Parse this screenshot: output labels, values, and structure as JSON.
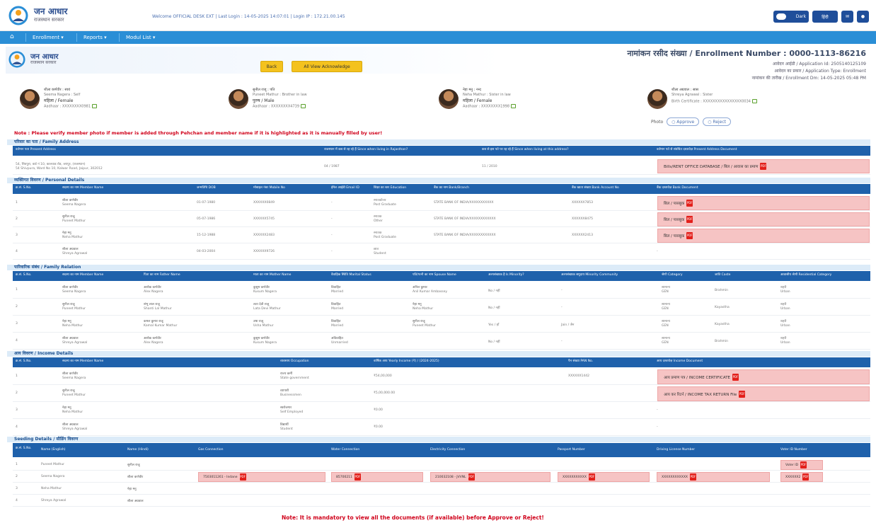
{
  "app": {
    "title": "जन आधार",
    "subtitle": "राजस्थान सरकार",
    "welcome": "Welcome OFFICIAL DESK EXT | Last Login : 14-05-2025 14:07:01 | Login IP : 172.21.00.145",
    "toggle_label": "Dark",
    "lang_button": "हिंदी",
    "logo_color": "#2a4d8f",
    "accent": "#1f61ab"
  },
  "nav": {
    "home_icon": "home-icon",
    "items": [
      "Enrollment ▾",
      "Reports ▾",
      "Modul List ▾"
    ]
  },
  "header": {
    "logo_title": "जन आधार",
    "logo_sub": "राजस्थान सरकार",
    "back_button": "Back",
    "view_btn": "All View Acknowledge",
    "enrollment": "नामांकन रसीद संख्या / Enrollment Number : 0000-1113-86216",
    "application_id": "आवेदन आईडी / Application Id: 2505140125109",
    "application_type": "आवेदन का प्रकार / Application Type: Enrollment",
    "enrollment_date": "नामांकन की तारीख / Enrollment Dm: 14-05-2025 05:48 PM"
  },
  "members": [
    {
      "l1": "शीला कर्णवीर : स्वयं",
      "l2": "Seema Nagera : Self",
      "l3": "महिला / Female",
      "l4": "Aadhaar : XXXXXXXX0981"
    },
    {
      "l1": "सुनील राजू : पति",
      "l2": "Puneet Mathur : Brother in law",
      "l3": "पुरुष / Male",
      "l4": "Aadhaar : XXXXXXXX4739"
    },
    {
      "l1": "नेहा मनु : नन्द",
      "l2": "Neha Mathur : Sister in law",
      "l3": "महिला / Female",
      "l4": "Aadhaar : XXXXXXXX1998"
    },
    {
      "l1": "शीला अग्रवाल : सास",
      "l2": "Shreya Agrawal : Sister",
      "l3": "",
      "l4": "Birth Certificate : XXXXXXXXXXXXXXXX0034"
    }
  ],
  "photo": {
    "label": "Photo",
    "approve": "Approve",
    "reject": "Reject"
  },
  "note_top": "Note : Please verify member photo if member is added through Pehchan and member name if it is highlighted as it is manually filled by user!",
  "family_address": {
    "title": "परिवार का पता / Family Address",
    "headers": [
      "वर्तमान पता Present Address",
      "राजस्थान में कब से रह रहे हैं Since when living in Rajasthan?",
      "कब से इस पते पर रह रहे हैं Since when living at this address?",
      "वर्तमान पते से संबंधित दस्तावेज़ Present Address Document"
    ],
    "row": [
      "54, शिवपुरा, वार्ड नं 10, कालवाड रोड, जयपुर, (राजस्थान)",
      "04 / 1987",
      "11 / 2010",
      "Bills/RENT OFFICE DATABASE / बिल / आवास का प्रमाण"
    ],
    "row_sub": "54 Shivpura, Ward No 10, Kalwar Road, Jaipur, 302012"
  },
  "personal": {
    "title": "व्यक्तिगत विवरण / Personal Details",
    "headers": [
      "क्र.सं. S.No.",
      "सदस्य का नाम Member Name",
      "जन्मतिथि DOB",
      "मोबाइल नंबर Mobile No",
      "ईमेल आईडी Email ID",
      "शिक्षा का स्तर Education",
      "बैंक का नाम Bank/Branch",
      "बैंक खाता संख्या Bank Account No",
      "बैंक दस्तावेज़ Bank Document"
    ],
    "rows": [
      [
        "1",
        "शीला कर्णवीर",
        "Seema Nagera",
        "01-07-1980",
        "XXXXXX0849",
        "-",
        "स्नातकोत्तर",
        "Post Graduate",
        "STATE BANK OF INDIA/XXXXXXXXXXX",
        "XXXXXX7853",
        "बिल / पासबुक"
      ],
      [
        "2",
        "सुनील राजू",
        "Puneet Mathur",
        "05-07-1986",
        "XXXXXX5745",
        "-",
        "स्नातक",
        "Other",
        "STATE BANK OF INDIA/XXXXXXXXXXXX",
        "XXXXXX8475",
        "बिल / पासबुक"
      ],
      [
        "3",
        "नेहा मनु",
        "Neha Mathur",
        "15-12-1988",
        "XXXXXX2483",
        "-",
        "स्नातक",
        "Post Graduate",
        "STATE BANK OF INDIA/XXXXXXXXXXXX",
        "XXXXXX2413",
        "बिल / पासबुक"
      ],
      [
        "4",
        "शीला अग्रवाल",
        "Shreya Agrawal",
        "04-03-2004",
        "XXXXXX9726",
        "-",
        "छात्र",
        "Student",
        "",
        "",
        "-"
      ]
    ]
  },
  "relation": {
    "title": "पारिवारिक संबंध / Family Relation",
    "headers": [
      "क्र.सं. S.No.",
      "सदस्य का नाम Member Name",
      "पिता का नाम Father Name",
      "माता का नाम Mother Name",
      "वैवाहिक स्थिति Marital Status",
      "पति/पत्नी का नाम Spouse Name",
      "अल्पसंख्यक है Is Minority?",
      "अल्पसंख्यक समुदाय Minority Community",
      "श्रेणी Category",
      "जाति Caste",
      "आवासीय श्रेणी Residential Category"
    ],
    "rows": [
      [
        "1",
        "शीला कर्णवीर",
        "Seema Nagera",
        "अशोक कर्णवीर",
        "Alex Nagera",
        "कुसुम कर्णवीर",
        "Kusum Nagera",
        "विवाहित",
        "Married",
        "अनिल कुमार",
        "Anil Kumar Ambassey",
        "No / नहीं",
        "-",
        "सामान्य",
        "GEN",
        "Brahmin",
        "शहरी",
        "Urban"
      ],
      [
        "2",
        "सुनील राजू",
        "Puneet Mathur",
        "शंभू लाल राजू",
        "Shanti Lal Mathur",
        "लता देवी राजू",
        "Lata Devi Mathur",
        "विवाहित",
        "Married",
        "नेहा मनु",
        "Neha Mathur",
        "No / नहीं",
        "-",
        "सामान्य",
        "GEN",
        "Kayastha",
        "शहरी",
        "Urban"
      ],
      [
        "3",
        "नेहा मनु",
        "Neha Mathur",
        "कमल कुमार राजू",
        "Kamal Kumar Mathur",
        "उषा राजू",
        "Usha Mathur",
        "विवाहित",
        "Married",
        "सुनील राजू",
        "Puneet Mathur",
        "Yes / हाँ",
        "Jain / जैन",
        "सामान्य",
        "GEN",
        "Kayastha",
        "शहरी",
        "Urban"
      ],
      [
        "4",
        "शीला अग्रवाल",
        "Shreya Agrawal",
        "अशोक कर्णवीर",
        "Alex Nagera",
        "कुसुम कर्णवीर",
        "Kusum Nagera",
        "अविवाहित",
        "Unmarried",
        "",
        "",
        "No / नहीं",
        "-",
        "सामान्य",
        "GEN",
        "Brahmin",
        "शहरी",
        "Urban"
      ]
    ]
  },
  "income": {
    "title": "आय विवरण / Income Details",
    "headers": [
      "क्र.सं. S.No.",
      "सदस्य का नाम Member Name",
      "व्यवसाय Occupation",
      "वार्षिक आय Yearly Income (₹) / (2024-2025)",
      "पैन संख्या PAN No.",
      "आय दस्तावेज़ Income Document"
    ],
    "rows": [
      [
        "1",
        "शीला कर्णवीर",
        "Seema Nagera",
        "राज्य कर्मी",
        "State government",
        "₹54,00,000",
        "XXXXXX1442",
        "आय प्रमाण पत्र / INCOME CERTIFICATE"
      ],
      [
        "2",
        "सुनील राजू",
        "Puneet Mathur",
        "व्यापारी",
        "Businessmen",
        "₹5,00,000.00",
        "",
        "आय कर रिटर्न / INCOME TAX RETURN File"
      ],
      [
        "3",
        "नेहा मनु",
        "Neha Mathur",
        "स्वरोजगार",
        "Self Employed",
        "₹0.00",
        "",
        "-"
      ],
      [
        "4",
        "शीला अग्रवाल",
        "Shreya Agrawal",
        "विद्यार्थी",
        "Student",
        "₹0.00",
        "",
        "-"
      ]
    ]
  },
  "seeding": {
    "title": "Seeding Details / सीडिंग विवरण",
    "headers": [
      "क्र.सं. S.No.",
      "Name (English)",
      "Name (Hindi)",
      "Gas Connection",
      "Water Connection",
      "Electricity Connection",
      "Passport Number",
      "Driving License Number",
      "Voter ID Number"
    ],
    "rows": [
      [
        "1",
        "Puneet Mathur",
        "सुनील राजू",
        "",
        "",
        "",
        "",
        "",
        "Voter ID"
      ],
      [
        "2",
        "Seema Nagera",
        "शीला कर्णवीर",
        "7503011261 - Indane",
        "85700211",
        "210032108 - JVVNL",
        "XXXXXXXXXXX",
        "XXXXXXXXXXXX",
        "XXXXXX2"
      ],
      [
        "3",
        "Neha Mathur",
        "नेहा मनु",
        "",
        "",
        "",
        "",
        "",
        ""
      ],
      [
        "4",
        "Shreya Agrawal",
        "शीला अग्रवाल",
        "",
        "",
        "",
        "",
        "",
        ""
      ]
    ]
  },
  "note_bottom": "Note: It is mandatory to view all the documents (if available) before Approve or Reject!"
}
